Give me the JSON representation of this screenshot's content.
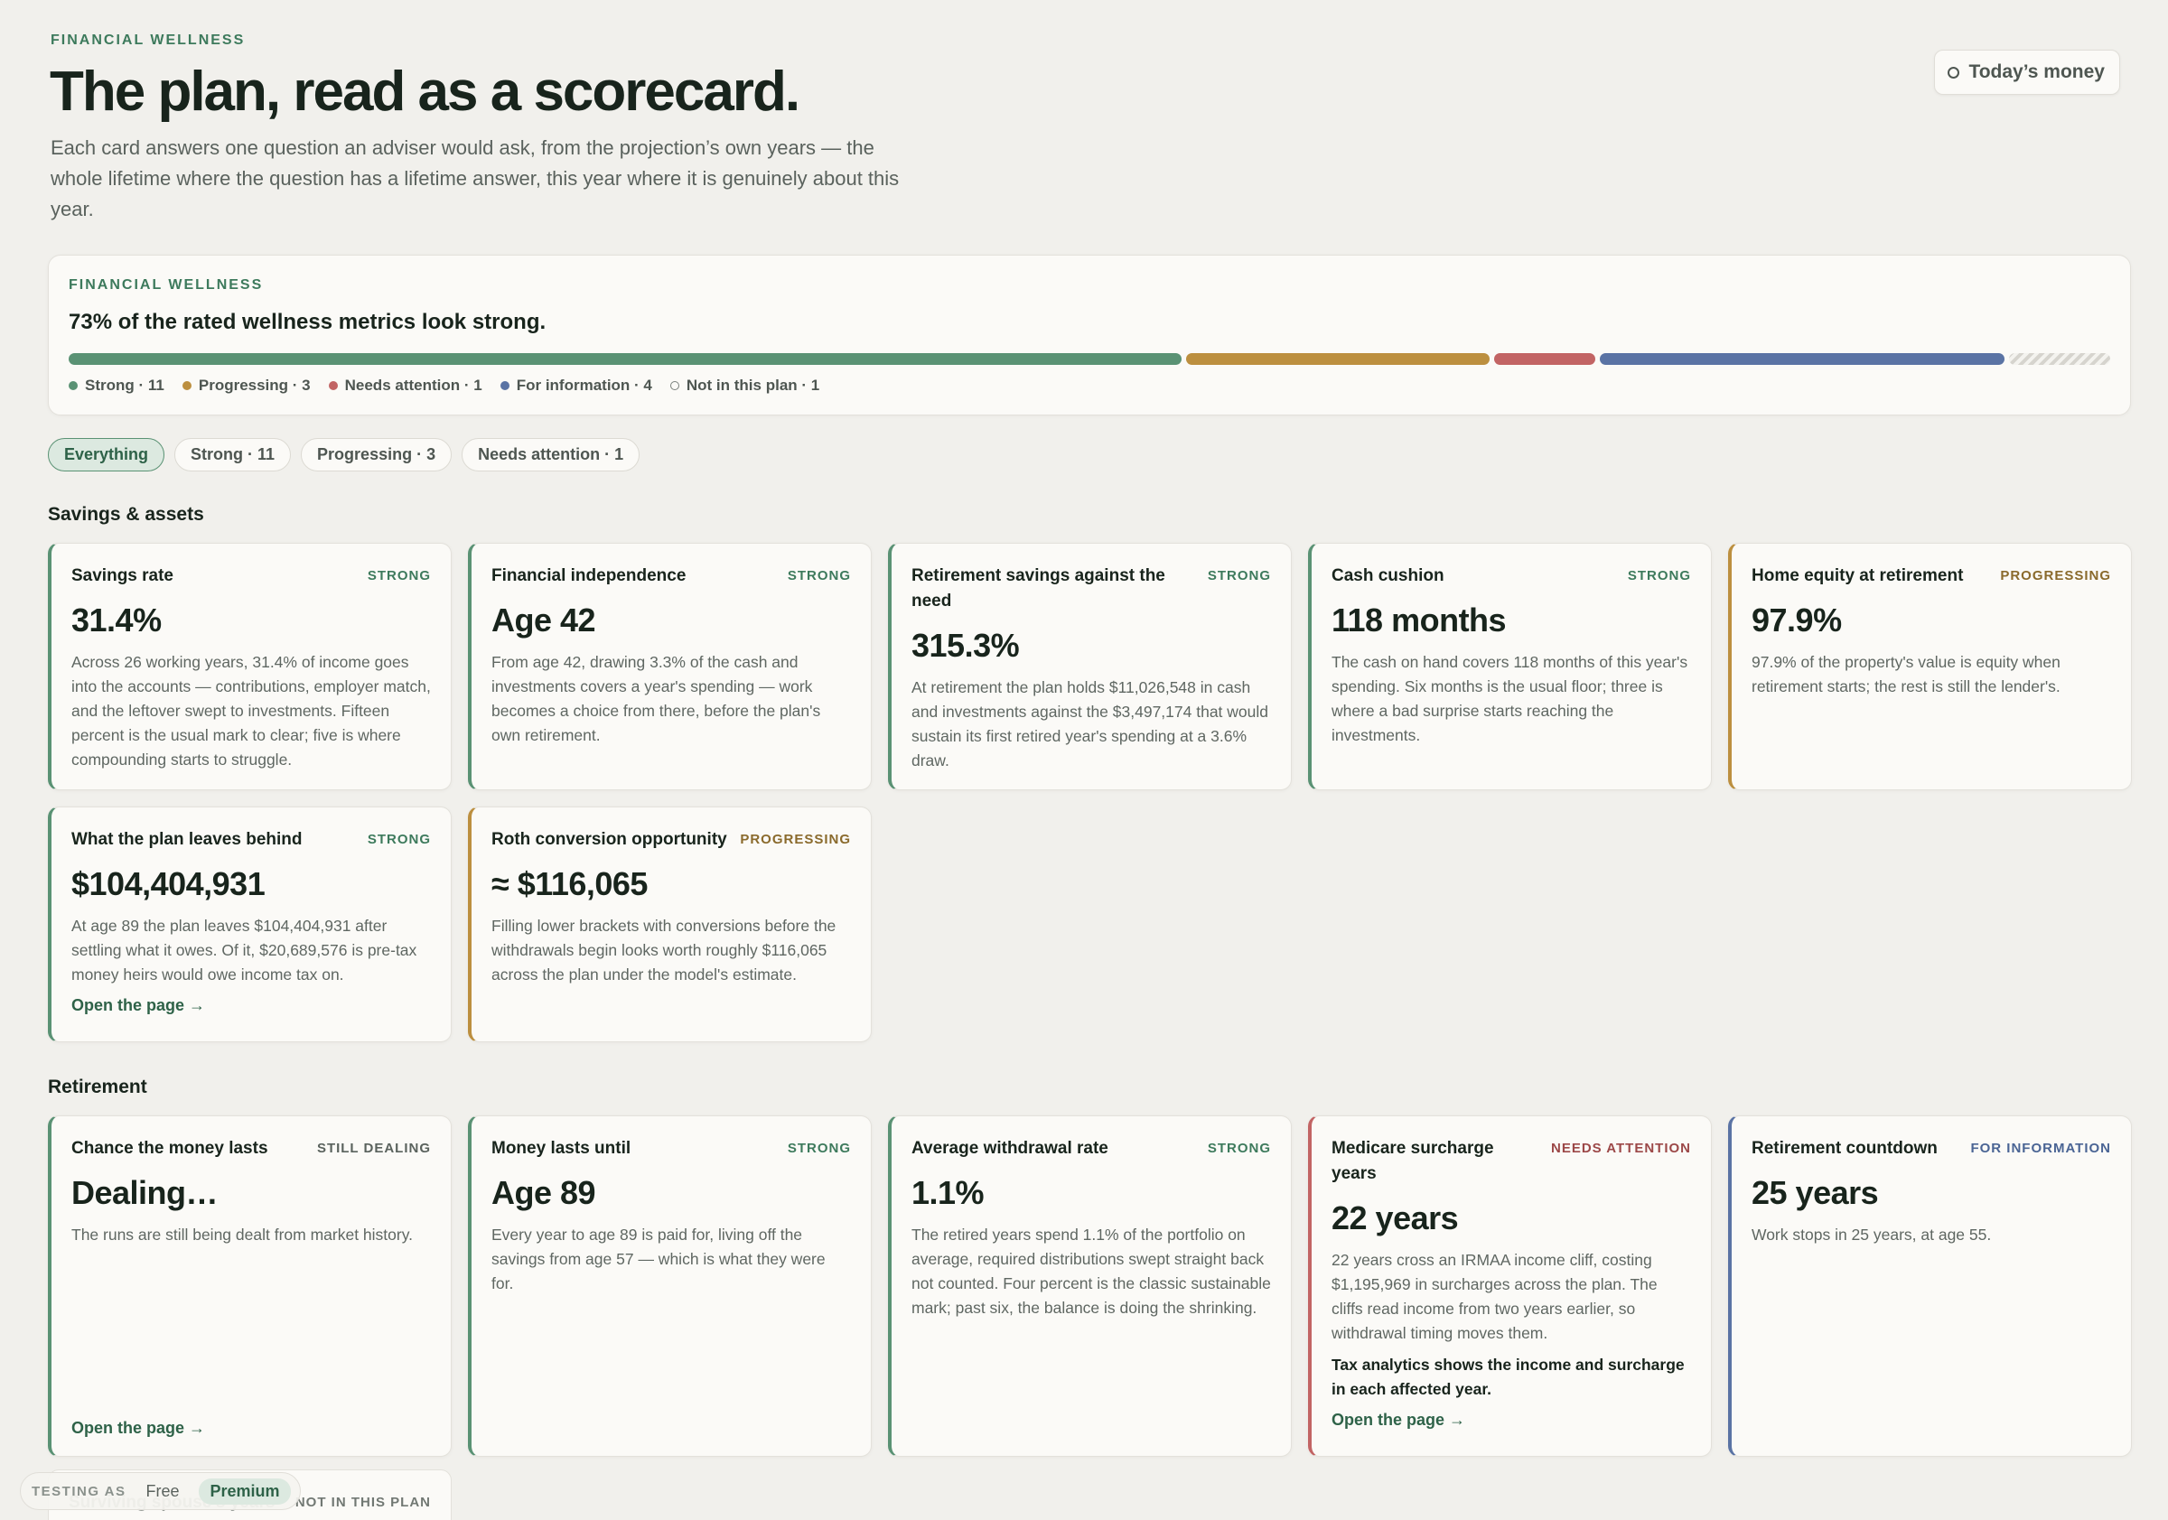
{
  "header": {
    "eyebrow": "FINANCIAL WELLNESS",
    "title": "The plan, read as a scorecard.",
    "lede": "Each card answers one question an adviser would ask, from the projection’s own years — the whole lifetime where the question has a lifetime answer, this year where it is genuinely about this year.",
    "money_button": "Today’s money"
  },
  "summary": {
    "eyebrow": "FINANCIAL WELLNESS",
    "headline": "73% of the rated wellness metrics look strong.",
    "segments": [
      {
        "key": "strong",
        "count": 11,
        "color": "#5a9274"
      },
      {
        "key": "progressing",
        "count": 3,
        "color": "#bc8f3f"
      },
      {
        "key": "needs",
        "count": 1,
        "color": "#c26464"
      },
      {
        "key": "info",
        "count": 4,
        "color": "#5a73a4"
      },
      {
        "key": "na",
        "count": 1,
        "color": "#d6d4ce"
      }
    ],
    "legend": {
      "strong": "Strong · 11",
      "progressing": "Progressing · 3",
      "needs": "Needs attention · 1",
      "info": "For information · 4",
      "na": "Not in this plan · 1"
    }
  },
  "filters": {
    "everything": "Everything",
    "strong": "Strong · 11",
    "progressing": "Progressing · 3",
    "needs": "Needs attention · 1"
  },
  "savings": {
    "title": "Savings & assets",
    "cards": [
      {
        "title": "Savings rate",
        "badge": "STRONG",
        "metric": "31.4%",
        "desc": "Across 26 working years, 31.4% of income goes into the accounts — contributions, employer match, and the leftover swept to investments. Fifteen percent is the usual mark to clear; five is where compounding starts to struggle."
      },
      {
        "title": "Financial independence",
        "badge": "STRONG",
        "metric": "Age 42",
        "desc": "From age 42, drawing 3.3% of the cash and investments covers a year's spending — work becomes a choice from there, before the plan's own retirement."
      },
      {
        "title": "Retirement savings against the need",
        "badge": "STRONG",
        "metric": "315.3%",
        "desc": "At retirement the plan holds $11,026,548 in cash and investments against the $3,497,174 that would sustain its first retired year's spending at a 3.6% draw."
      },
      {
        "title": "Cash cushion",
        "badge": "STRONG",
        "metric": "118 months",
        "desc": "The cash on hand covers 118 months of this year's spending. Six months is the usual floor; three is where a bad surprise starts reaching the investments."
      },
      {
        "title": "Home equity at retirement",
        "badge": "PROGRESSING",
        "metric": "97.9%",
        "desc": "97.9% of the property's value is equity when retirement starts; the rest is still the lender's."
      },
      {
        "title": "What the plan leaves behind",
        "badge": "STRONG",
        "metric": "$104,404,931",
        "desc": "At age 89 the plan leaves $104,404,931 after settling what it owes. Of it, $20,689,576 is pre-tax money heirs would owe income tax on.",
        "link": "Open the page →"
      },
      {
        "title": "Roth conversion opportunity",
        "badge": "PROGRESSING",
        "metric": "≈ $116,065",
        "desc": "Filling lower brackets with conversions before the withdrawals begin looks worth roughly $116,065 across the plan under the model's estimate."
      }
    ]
  },
  "retirement": {
    "title": "Retirement",
    "cards": [
      {
        "title": "Chance the money lasts",
        "badge": "STILL DEALING",
        "metric": "Dealing…",
        "desc": "The runs are still being dealt from market history.",
        "link": "Open the page →"
      },
      {
        "title": "Money lasts until",
        "badge": "STRONG",
        "metric": "Age 89",
        "desc": "Every year to age 89 is paid for, living off the savings from age 57 — which is what they were for."
      },
      {
        "title": "Average withdrawal rate",
        "badge": "STRONG",
        "metric": "1.1%",
        "desc": "The retired years spend 1.1% of the portfolio on average, required distributions swept straight back not counted. Four percent is the classic sustainable mark; past six, the balance is doing the shrinking."
      },
      {
        "title": "Medicare surcharge years",
        "badge": "NEEDS ATTENTION",
        "metric": "22 years",
        "desc": "22 years cross an IRMAA income cliff, costing $1,195,969 in surcharges across the plan. The cliffs read income from two years earlier, so withdrawal timing moves them.",
        "note": "Tax analytics shows the income and surcharge in each affected year.",
        "link": "Open the page →"
      },
      {
        "title": "Retirement countdown",
        "badge": "FOR INFORMATION",
        "metric": "25 years",
        "desc": "Work stops in 25 years, at age 55."
      }
    ],
    "peek": {
      "title": "Surviving spouse's years",
      "badge": "NOT IN THIS PLAN"
    }
  },
  "testing": {
    "label": "TESTING AS",
    "free": "Free",
    "premium": "Premium"
  }
}
